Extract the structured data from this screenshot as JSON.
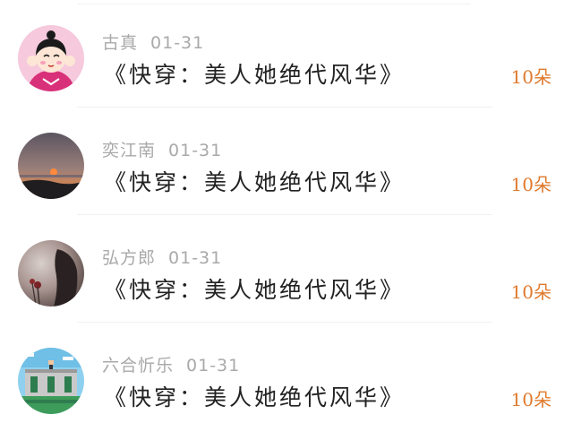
{
  "comments": [
    {
      "name": "古真",
      "date": "01-31",
      "book_title": "《快穿：美人她绝代风华》",
      "count": "10朵",
      "avatar_icon": "cartoon-girl-avatar"
    },
    {
      "name": "奕江南",
      "date": "01-31",
      "book_title": "《快穿：美人她绝代风华》",
      "count": "10朵",
      "avatar_icon": "sunset-photo-avatar"
    },
    {
      "name": "弘方郎",
      "date": "01-31",
      "book_title": "《快穿：美人她绝代风华》",
      "count": "10朵",
      "avatar_icon": "dark-flower-photo-avatar"
    },
    {
      "name": "六合忻乐",
      "date": "01-31",
      "book_title": "《快穿：美人她绝代风华》",
      "count": "10朵",
      "avatar_icon": "pixel-castle-avatar"
    }
  ],
  "colors": {
    "name": "#a9a9a9",
    "title": "#222222",
    "count": "#e07a2e"
  }
}
